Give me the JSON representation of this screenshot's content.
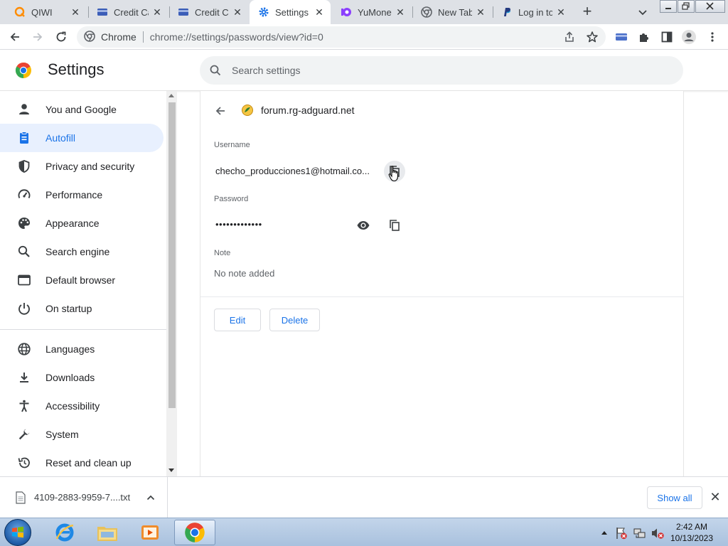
{
  "tabs": [
    {
      "title": "QIWI",
      "icon": "qiwi-icon",
      "active": false
    },
    {
      "title": "Credit Ca",
      "icon": "card-icon",
      "active": false
    },
    {
      "title": "Credit Ca",
      "icon": "card-icon",
      "active": false
    },
    {
      "title": "Settings",
      "icon": "gear-icon",
      "active": true
    },
    {
      "title": "YuMoney",
      "icon": "yumoney-icon",
      "active": false
    },
    {
      "title": "New Tab",
      "icon": "chrome-icon",
      "active": false
    },
    {
      "title": "Log in to",
      "icon": "paypal-icon",
      "active": false
    }
  ],
  "toolbar": {
    "chip_label": "Chrome",
    "url": "chrome://settings/passwords/view?id=0"
  },
  "header": {
    "title": "Settings",
    "search_placeholder": "Search settings"
  },
  "sidebar": {
    "items": [
      {
        "label": "You and Google",
        "icon": "person-icon"
      },
      {
        "label": "Autofill",
        "icon": "autofill-icon",
        "selected": true
      },
      {
        "label": "Privacy and security",
        "icon": "shield-icon"
      },
      {
        "label": "Performance",
        "icon": "speedometer-icon"
      },
      {
        "label": "Appearance",
        "icon": "palette-icon"
      },
      {
        "label": "Search engine",
        "icon": "search-icon"
      },
      {
        "label": "Default browser",
        "icon": "browser-icon"
      },
      {
        "label": "On startup",
        "icon": "power-icon"
      },
      {
        "label": "Languages",
        "icon": "globe-icon"
      },
      {
        "label": "Downloads",
        "icon": "download-icon"
      },
      {
        "label": "Accessibility",
        "icon": "accessibility-icon"
      },
      {
        "label": "System",
        "icon": "wrench-icon"
      },
      {
        "label": "Reset and clean up",
        "icon": "reset-icon"
      }
    ]
  },
  "detail": {
    "site": "forum.rg-adguard.net",
    "username_label": "Username",
    "username_value": "checho_producciones1@hotmail.co...",
    "password_label": "Password",
    "password_value": "•••••••••••••",
    "note_label": "Note",
    "note_value": "No note added",
    "edit_label": "Edit",
    "delete_label": "Delete"
  },
  "download_shelf": {
    "filename": "4109-2883-9959-7....txt",
    "show_all_label": "Show all"
  },
  "taskbar": {
    "time": "2:42 AM",
    "date": "10/13/2023"
  },
  "colors": {
    "accent": "#1a73e8",
    "selected_bg": "#e8f0fe",
    "tabstrip_bg": "#dee1e6"
  }
}
